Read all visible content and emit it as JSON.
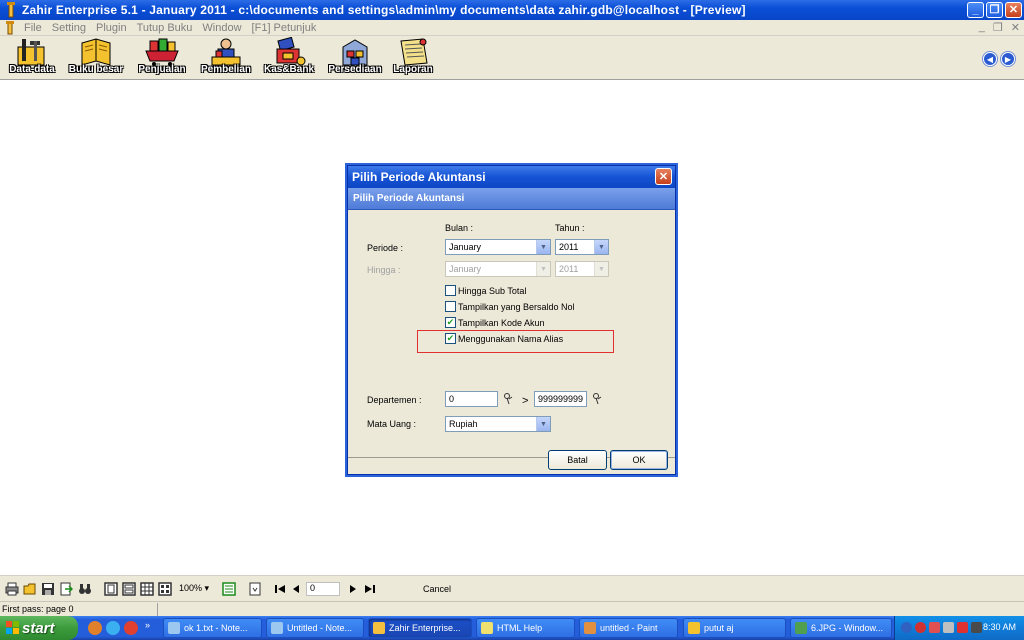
{
  "window": {
    "title": "Zahir Enterprise 5.1 - January 2011 - c:\\documents and settings\\admin\\my documents\\data zahir.gdb@localhost - [Preview]"
  },
  "menu": [
    "File",
    "Setting",
    "Plugin",
    "Tutup Buku",
    "Window",
    "[F1] Petunjuk"
  ],
  "toolbar": {
    "items": [
      {
        "label": "Data-data",
        "icon": "tools-icon"
      },
      {
        "label": "Buku besar",
        "icon": "book-icon"
      },
      {
        "label": "Penjualan",
        "icon": "shopping-cart-icon"
      },
      {
        "label": "Pembelian",
        "icon": "cashier-icon"
      },
      {
        "label": "Kas&Bank",
        "icon": "cash-icon"
      },
      {
        "label": "Persediaan",
        "icon": "warehouse-icon"
      },
      {
        "label": "Laporan",
        "icon": "report-icon"
      }
    ]
  },
  "dialog": {
    "title": "Pilih Periode Akuntansi",
    "header": "Pilih Periode Akuntansi",
    "bulan_label": "Bulan :",
    "tahun_label": "Tahun :",
    "periode_label": "Periode :",
    "hingga_label": "Hingga :",
    "periode_bulan": "January",
    "periode_tahun": "2011",
    "hingga_bulan": "January",
    "hingga_tahun": "2011",
    "checkboxes": [
      {
        "label": "Hingga Sub Total",
        "checked": false
      },
      {
        "label": "Tampilkan yang Bersaldo Nol",
        "checked": false
      },
      {
        "label": "Tampilkan Kode Akun",
        "checked": true
      },
      {
        "label": "Menggunakan Nama Alias",
        "checked": true
      }
    ],
    "departemen_label": "Departemen :",
    "departemen_from": "0",
    "departemen_sep": ">",
    "departemen_to": "999999999",
    "mata_uang_label": "Mata Uang :",
    "mata_uang": "Rupiah",
    "cancel_label": "Batal",
    "ok_label": "OK"
  },
  "preview_toolbar": {
    "zoom": "100%",
    "page": "0",
    "cancel": "Cancel"
  },
  "status": "First pass: page 0",
  "taskbar": {
    "start": "start",
    "tasks": [
      "ok 1.txt - Note...",
      "Untitled - Note...",
      "Zahir Enterprise...",
      "HTML Help",
      "untitled - Paint",
      "putut aj",
      "6.JPG - Window..."
    ],
    "clock": "8:30 AM"
  },
  "colors": {
    "title_blue": "#0a4fd6",
    "dialog_header": "#4e7bd8",
    "highlight_red": "#e03030",
    "taskbar_blue": "#245edb",
    "start_green": "#3c9b3c"
  }
}
